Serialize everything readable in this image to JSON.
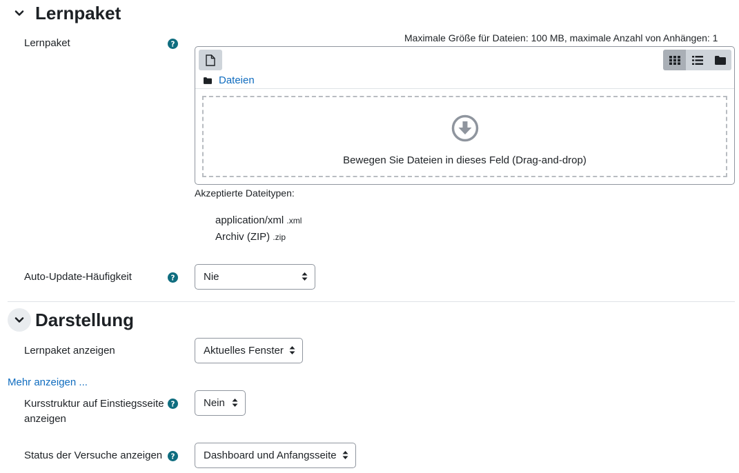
{
  "section_lernpaket": {
    "title": "Lernpaket",
    "field_label": "Lernpaket",
    "max_info": "Maximale Größe für Dateien: 100 MB, maximale Anzahl von Anhängen: 1",
    "path_label": "Dateien",
    "drop_text": "Bewegen Sie Dateien in dieses Feld (Drag-and-drop)",
    "accepted_label": "Akzeptierte Dateitypen:",
    "file_types": [
      {
        "name": "application/xml",
        "ext": ".xml"
      },
      {
        "name": "Archiv (ZIP)",
        "ext": ".zip"
      }
    ],
    "auto_update_label": "Auto-Update-Häufigkeit",
    "auto_update_value": "Nie"
  },
  "section_darstellung": {
    "title": "Darstellung",
    "display_label": "Lernpaket anzeigen",
    "display_value": "Aktuelles Fenster",
    "more_link": "Mehr anzeigen ...",
    "course_structure_label_1": "Kursstruktur auf Einstiegsseite",
    "course_structure_label_2": "anzeigen",
    "course_structure_value": "Nein",
    "attempt_status_label": "Status der Versuche anzeigen",
    "attempt_status_value": "Dashboard und Anfangsseite"
  },
  "colors": {
    "help_icon": "#0f6d7f",
    "link": "#0f6cbf",
    "text": "#1d2125"
  }
}
